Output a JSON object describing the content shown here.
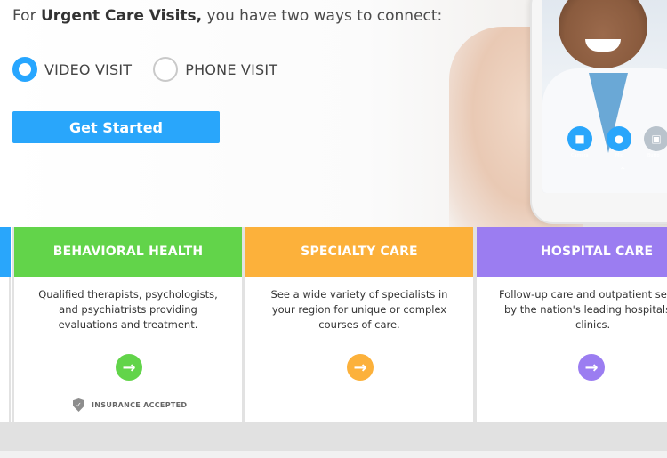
{
  "hero": {
    "intro_prefix": "For ",
    "intro_bold": "Urgent Care Visits,",
    "intro_suffix": " you have two ways to connect:",
    "options": [
      {
        "label": "VIDEO VISIT",
        "selected": true
      },
      {
        "label": "PHONE VISIT",
        "selected": false
      }
    ],
    "cta_label": "Get Started",
    "phone_controls": [
      "Camera",
      "Mic",
      "Butto"
    ]
  },
  "cards": [
    {
      "title": "BEHAVIORAL HEALTH",
      "color": "#62d44a",
      "description": "Qualified therapists, psychologists, and psychiatrists providing evaluations and treatment.",
      "badge": "INSURANCE ACCEPTED"
    },
    {
      "title": "SPECIALTY CARE",
      "color": "#fcb13b",
      "description": "See a wide variety of specialists in your region for unique or complex courses of care."
    },
    {
      "title": "HOSPITAL CARE",
      "color": "#9b7df1",
      "description_lines": [
        "Follow-up care and outpatient serv",
        "by the nation's leading hospitals a",
        "clinics."
      ]
    }
  ],
  "colors": {
    "accent": "#29a6fb",
    "behavioral": "#62d44a",
    "specialty": "#fcb13b",
    "hospital": "#9b7df1"
  }
}
